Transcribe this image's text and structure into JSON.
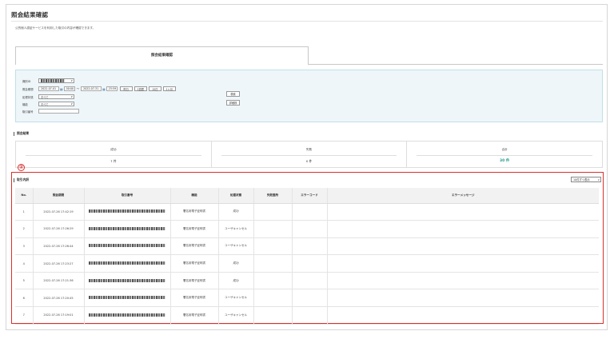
{
  "page": {
    "title": "照会結果確認",
    "description": "公的個人認証サービスを利用した取引の内容が確認できます。"
  },
  "tabs": [
    {
      "label": "照会結果確認",
      "active": true
    }
  ],
  "search": {
    "service_id_label": "識別ID",
    "period_label": "照会期間",
    "date_from": "2022-07-01",
    "time_from": "00:00",
    "range_separator": "～",
    "date_to": "2022-07-31",
    "time_to": "23:59",
    "quick_buttons": [
      "昨日",
      "1週間",
      "15日",
      "1ヶ月"
    ],
    "status_label": "処理状態",
    "status_value": "すべて",
    "function_label": "機能",
    "function_value": "すべて",
    "txn_no_label": "取引番号",
    "txn_no_value": "",
    "search_button": "検索",
    "detail_button": "詳細検"
  },
  "summary_section": {
    "title": "照会結果",
    "columns": [
      {
        "label": "成功",
        "value": "7 件"
      },
      {
        "label": "失敗",
        "value": "0 件"
      },
      {
        "label": "合計",
        "value": "30 件"
      }
    ]
  },
  "annotation": {
    "marker": "②",
    "color": "#d9302c"
  },
  "details_section": {
    "title": "取引内訳",
    "page_size": "10件ずつ表示",
    "columns": [
      "No.",
      "照会期間",
      "取引番号",
      "機能",
      "処理状態",
      "失敗箇所",
      "エラーコード",
      "エラーメッセージ"
    ],
    "rows": [
      {
        "no": "1",
        "datetime": "2022-07-26 17:42:19",
        "function": "署名用電子証明書",
        "status": "成功",
        "fail": "",
        "code": "",
        "message": ""
      },
      {
        "no": "2",
        "datetime": "2022-07-26 17:26:29",
        "function": "署名用電子証明書",
        "status": "ユーザキャンセル",
        "fail": "",
        "code": "",
        "message": ""
      },
      {
        "no": "3",
        "datetime": "2022-07-26 17:26:44",
        "function": "署名用電子証明書",
        "status": "ユーザキャンセル",
        "fail": "",
        "code": "",
        "message": ""
      },
      {
        "no": "4",
        "datetime": "2022-07-26 17:23:27",
        "function": "署名用電子証明書",
        "status": "成功",
        "fail": "",
        "code": "",
        "message": ""
      },
      {
        "no": "5",
        "datetime": "2022-07-26 17:21:36",
        "function": "署名用電子証明書",
        "status": "成功",
        "fail": "",
        "code": "",
        "message": ""
      },
      {
        "no": "6",
        "datetime": "2022-07-26 17:20:45",
        "function": "署名用電子証明書",
        "status": "ユーザキャンセル",
        "fail": "",
        "code": "",
        "message": ""
      },
      {
        "no": "7",
        "datetime": "2022-07-26 17:19:01",
        "function": "署名用電子証明書",
        "status": "ユーザキャンセル",
        "fail": "",
        "code": "",
        "message": ""
      }
    ]
  },
  "colors": {
    "accent_total": "#2a9d8f",
    "panel_bg": "#eef6f9",
    "annotation": "#d9302c"
  }
}
